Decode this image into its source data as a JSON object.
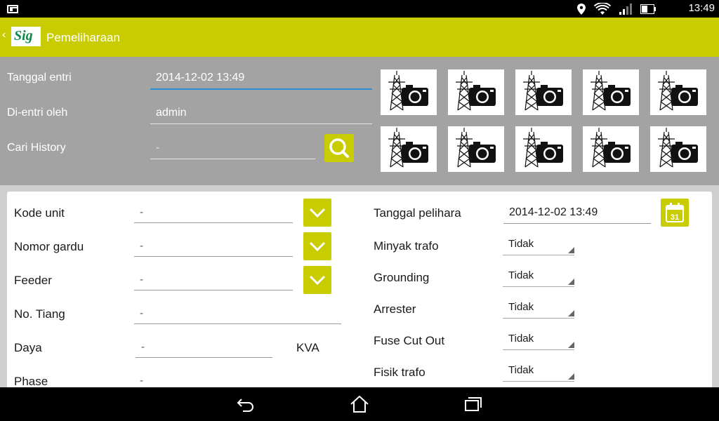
{
  "status_bar": {
    "time": "13:49"
  },
  "app_bar": {
    "logo_text": "Sig",
    "title": "Pemeliharaan"
  },
  "header": {
    "entry_date_label": "Tanggal entri",
    "entry_date_value": "2014-12-02 13:49",
    "entered_by_label": "Di-entri oleh",
    "entered_by_value": "admin",
    "history_label": "Cari History",
    "history_value": "-"
  },
  "form": {
    "left": {
      "unit_code_label": "Kode unit",
      "unit_code_value": "-",
      "substation_number_label": "Nomor gardu",
      "substation_number_value": "-",
      "feeder_label": "Feeder",
      "feeder_value": "-",
      "pole_number_label": "No. Tiang",
      "pole_number_value": "-",
      "power_label": "Daya",
      "power_value": "-",
      "power_unit": "KVA",
      "phase_label": "Phase",
      "phase_value": "-"
    },
    "right": {
      "maintenance_date_label": "Tanggal pelihara",
      "maintenance_date_value": "2014-12-02 13:49",
      "calendar_day": "31",
      "trafo_oil_label": "Minyak trafo",
      "trafo_oil_value": "Tidak",
      "grounding_label": "Grounding",
      "grounding_value": "Tidak",
      "arrester_label": "Arrester",
      "arrester_value": "Tidak",
      "fuse_cut_out_label": "Fuse Cut Out",
      "fuse_cut_out_value": "Tidak",
      "trafo_physical_label": "Fisik trafo",
      "trafo_physical_value": "Tidak"
    }
  },
  "colors": {
    "accent": "#c8cc00",
    "header_bg": "#a3a3a3",
    "focus_line": "#2b8fd6"
  },
  "icons": [
    "gallery-icon",
    "location-icon",
    "wifi-icon",
    "signal-icon",
    "battery-icon",
    "search-icon",
    "chevron-down-icon",
    "calendar-icon",
    "tower-camera-icon",
    "back-icon",
    "home-icon",
    "recents-icon"
  ]
}
